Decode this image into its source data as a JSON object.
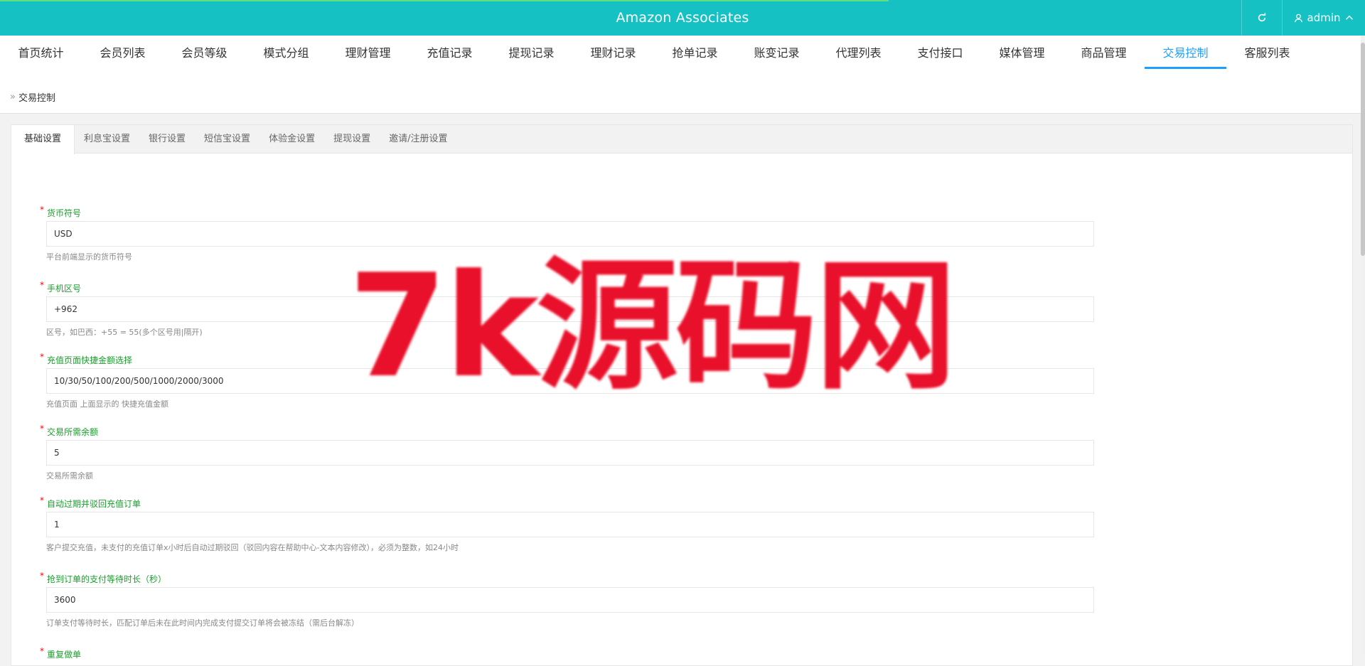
{
  "header": {
    "title": "Amazon Associates",
    "username": "admin"
  },
  "nav": {
    "items": [
      "首页统计",
      "会员列表",
      "会员等级",
      "模式分组",
      "理财管理",
      "充值记录",
      "提现记录",
      "理财记录",
      "抢单记录",
      "账变记录",
      "代理列表",
      "支付接口",
      "媒体管理",
      "商品管理",
      "交易控制",
      "客服列表"
    ],
    "active": "交易控制"
  },
  "breadcrumb": {
    "label": "交易控制"
  },
  "tabs": {
    "items": [
      "基础设置",
      "利息宝设置",
      "银行设置",
      "短信宝设置",
      "体验金设置",
      "提现设置",
      "邀请/注册设置"
    ],
    "active": "基础设置"
  },
  "form": {
    "fields": [
      {
        "label": "货币符号",
        "value": "USD",
        "help": "平台前端显示的货币符号"
      },
      {
        "label": "手机区号",
        "value": "+962",
        "help": "区号，如巴西：+55 = 55(多个区号用|隔开)"
      },
      {
        "label": "充值页面快捷金额选择",
        "value": "10/30/50/100/200/500/1000/2000/3000",
        "help": "充值页面 上面显示的 快捷充值金额"
      },
      {
        "label": "交易所需余额",
        "value": "5",
        "help": "交易所需余额"
      },
      {
        "label": "自动过期并驳回充值订单",
        "value": "1",
        "help": "客户提交充值，未支付的充值订单x小时后自动过期驳回（驳回内容在帮助中心-文本内容修改），必须为整数，如24小时"
      },
      {
        "label": "抢到订单的支付等待时长（秒）",
        "value": "3600",
        "help": "订单支付等待时长，匹配订单后未在此时间内完成支付提交订单将会被冻结（需后台解冻）"
      },
      {
        "label": "重复做单",
        "value": "",
        "help": ""
      }
    ]
  },
  "watermark": {
    "text": "7k源码网"
  },
  "colors": {
    "header": "#16c1c4",
    "active_nav": "#1e9fff",
    "label_green": "#1a9e2b",
    "required_star": "#ff0000",
    "watermark": "#e8102a"
  },
  "icons": {
    "refresh": "refresh-icon",
    "user": "user-icon",
    "chevron_up": "chevron-up-icon",
    "breadcrumb": "double-chevron-right-icon"
  }
}
